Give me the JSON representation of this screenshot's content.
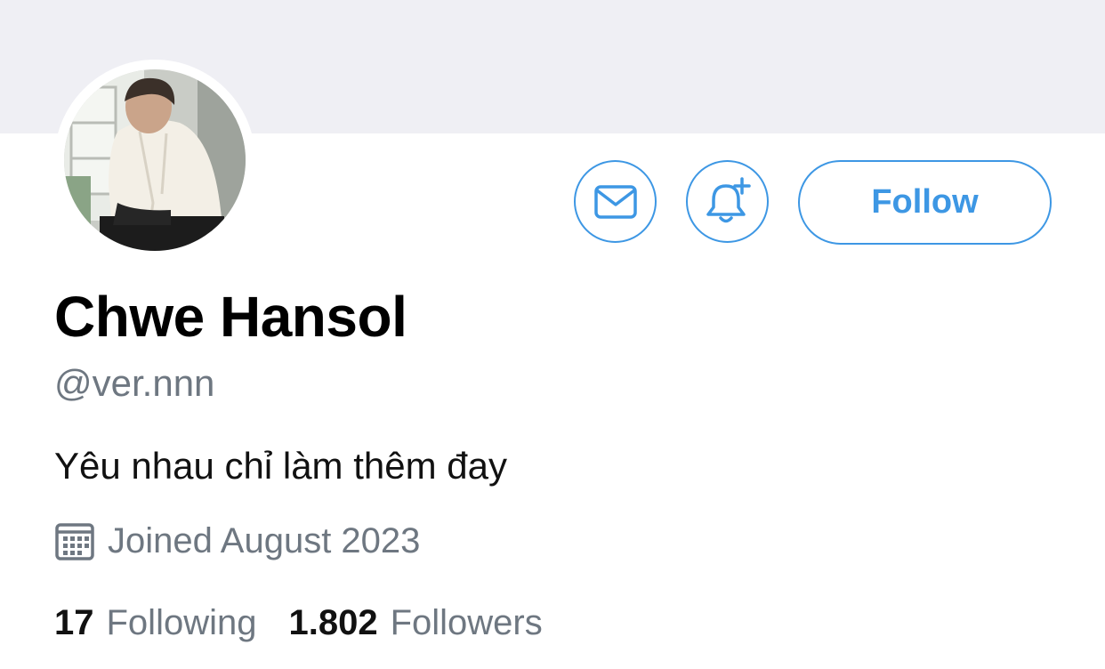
{
  "profile": {
    "display_name": "Chwe Hansol",
    "handle": "@ver.nnn",
    "bio": "Yêu nhau chỉ làm thêm đay",
    "joined": "Joined August 2023",
    "following_count": "17",
    "following_label": "Following",
    "followers_count": "1.802",
    "followers_label": "Followers"
  },
  "actions": {
    "follow_label": "Follow",
    "message_icon": "envelope-icon",
    "notify_icon": "bell-plus-icon"
  },
  "colors": {
    "accent": "#3d97e4",
    "secondary_text": "#6e7781",
    "banner": "#efeff4"
  }
}
